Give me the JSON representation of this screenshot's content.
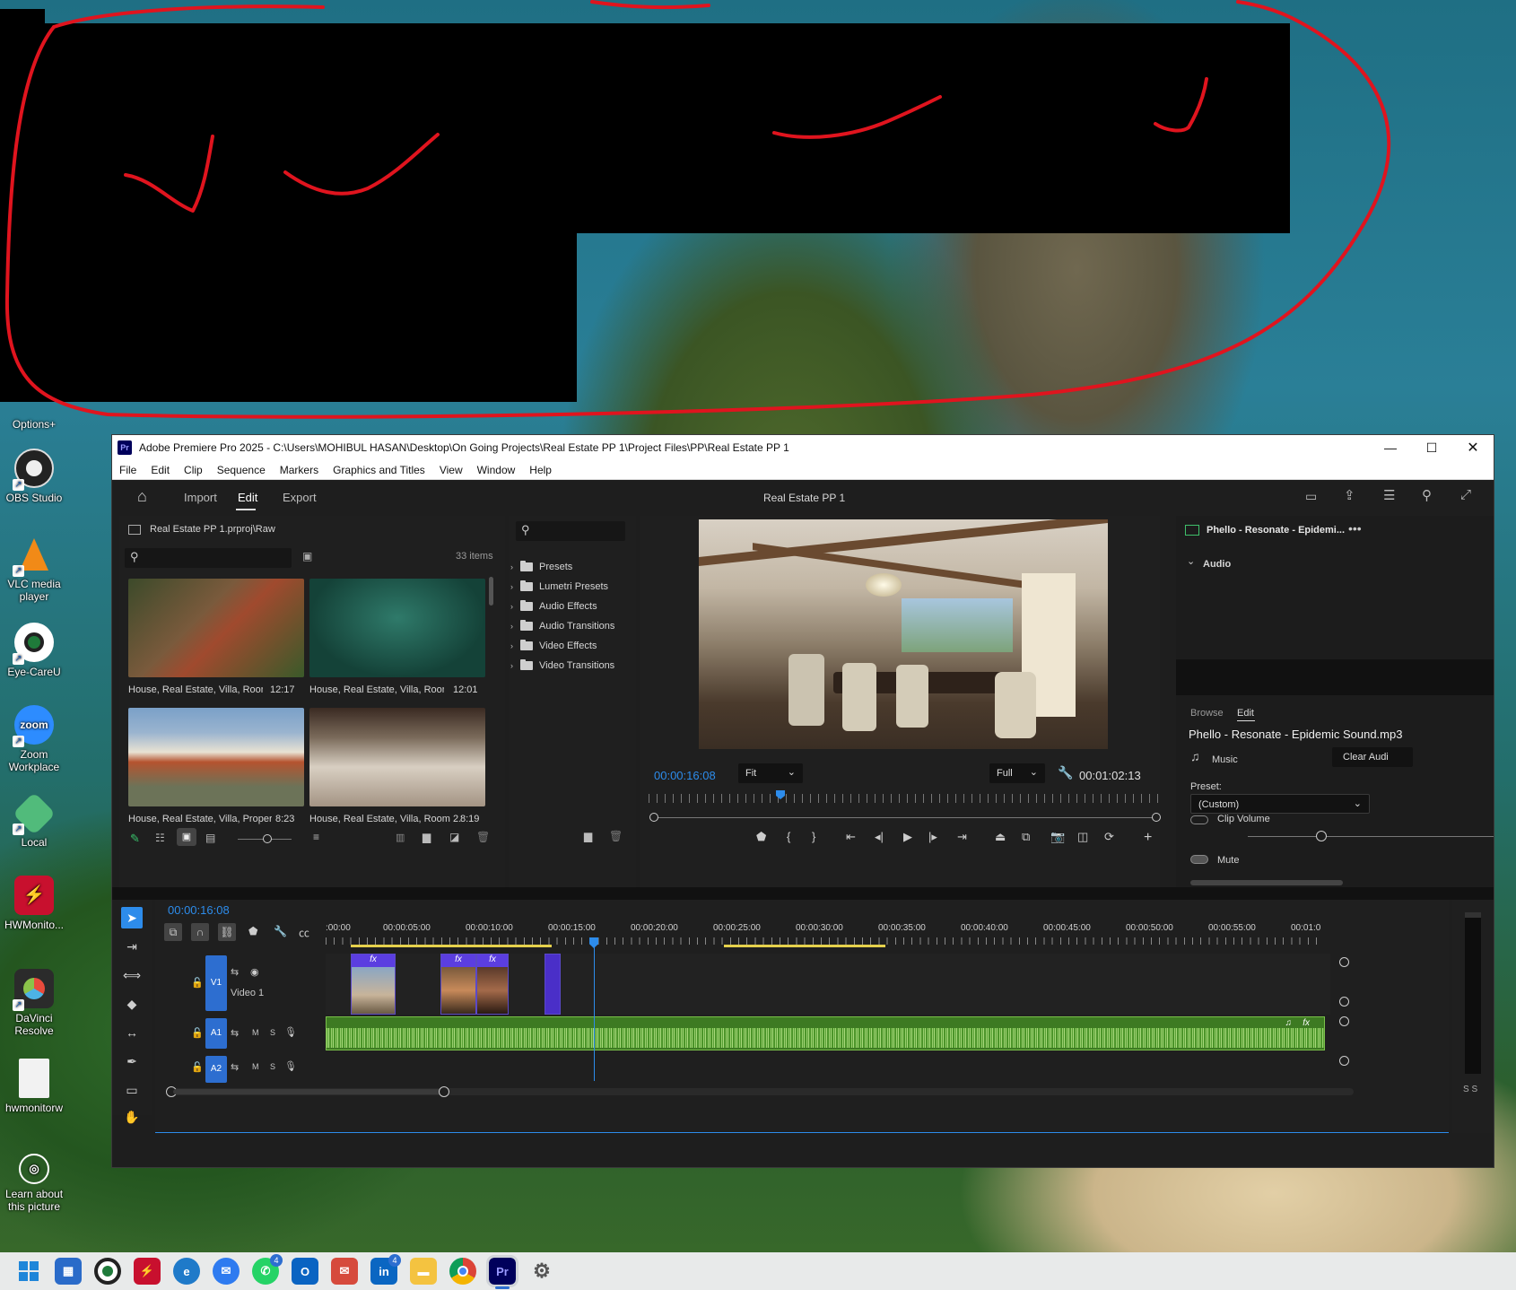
{
  "desktop": {
    "icons": [
      {
        "label": "Options+"
      },
      {
        "label": "OBS Studio"
      },
      {
        "label": "VLC media player"
      },
      {
        "label": "Eye-CareU"
      },
      {
        "label": "Zoom Workplace",
        "logo": "zoom"
      },
      {
        "label": "Local"
      },
      {
        "label": "HWMonito..."
      },
      {
        "label": "DaVinci Resolve"
      },
      {
        "label": "hwmonitorw"
      },
      {
        "label": "Learn about this picture"
      }
    ]
  },
  "window": {
    "title": "Adobe Premiere Pro 2025 - C:\\Users\\MOHIBUL HASAN\\Desktop\\On Going Projects\\Real Estate PP 1\\Project Files\\PP\\Real Estate PP 1",
    "app_badge": "Pr",
    "menu": [
      "File",
      "Edit",
      "Clip",
      "Sequence",
      "Markers",
      "Graphics and Titles",
      "View",
      "Window",
      "Help"
    ]
  },
  "header": {
    "tabs": [
      "Import",
      "Edit",
      "Export"
    ],
    "active_tab": "Edit",
    "sequence_title": "Real Estate PP 1"
  },
  "project": {
    "breadcrumb": "Real Estate PP 1.prproj\\Raw",
    "item_count": "33 items",
    "clips": [
      {
        "name": "House, Real Estate, Villa, Room ...",
        "duration": "12:17",
        "color": "#6a5a3e"
      },
      {
        "name": "House, Real Estate, Villa, Room ...",
        "duration": "12:01",
        "color": "#1f5a4c"
      },
      {
        "name": "House, Real Estate, Villa, Property ...",
        "duration": "8:23",
        "color": "#8c7a5a"
      },
      {
        "name": "House, Real Estate, Villa, Room 2.ts",
        "duration": "8:19",
        "color": "#8a7460"
      }
    ]
  },
  "effects": {
    "items": [
      "Presets",
      "Lumetri Presets",
      "Audio Effects",
      "Audio Transitions",
      "Video Effects",
      "Video Transitions"
    ]
  },
  "program": {
    "current_tc": "00:00:16:08",
    "zoom": "Fit",
    "quality": "Full",
    "duration_tc": "00:01:02:13"
  },
  "essential_sound": {
    "clip_name": "Phello - Resonate - Epidemi...",
    "section": "Audio",
    "tabs": [
      "Browse",
      "Edit"
    ],
    "full_name": "Phello - Resonate - Epidemic Sound.mp3",
    "type": "Music",
    "clear_btn": "Clear Audi",
    "preset_label": "Preset:",
    "preset_value": "(Custom)",
    "clip_volume": "Clip Volume",
    "mute": "Mute"
  },
  "timeline": {
    "current_tc": "00:00:16:08",
    "ruler": [
      ":00:00",
      "00:00:05:00",
      "00:00:10:00",
      "00:00:15:00",
      "00:00:20:00",
      "00:00:25:00",
      "00:00:30:00",
      "00:00:35:00",
      "00:00:40:00",
      "00:00:45:00",
      "00:00:50:00",
      "00:00:55:00",
      "00:01:0"
    ],
    "tracks": {
      "v1": {
        "id": "V1",
        "name": "Video 1"
      },
      "a1": {
        "id": "A1",
        "m": "M",
        "s": "S"
      },
      "a2": {
        "id": "A2",
        "m": "M",
        "s": "S"
      }
    },
    "fx_label": "fx",
    "meter_label": "S S"
  },
  "taskbar": {
    "notif_whatsapp": "4",
    "notif_linkedin": "4",
    "outlook": "O",
    "linkedin": "in",
    "premiere": "Pr"
  }
}
